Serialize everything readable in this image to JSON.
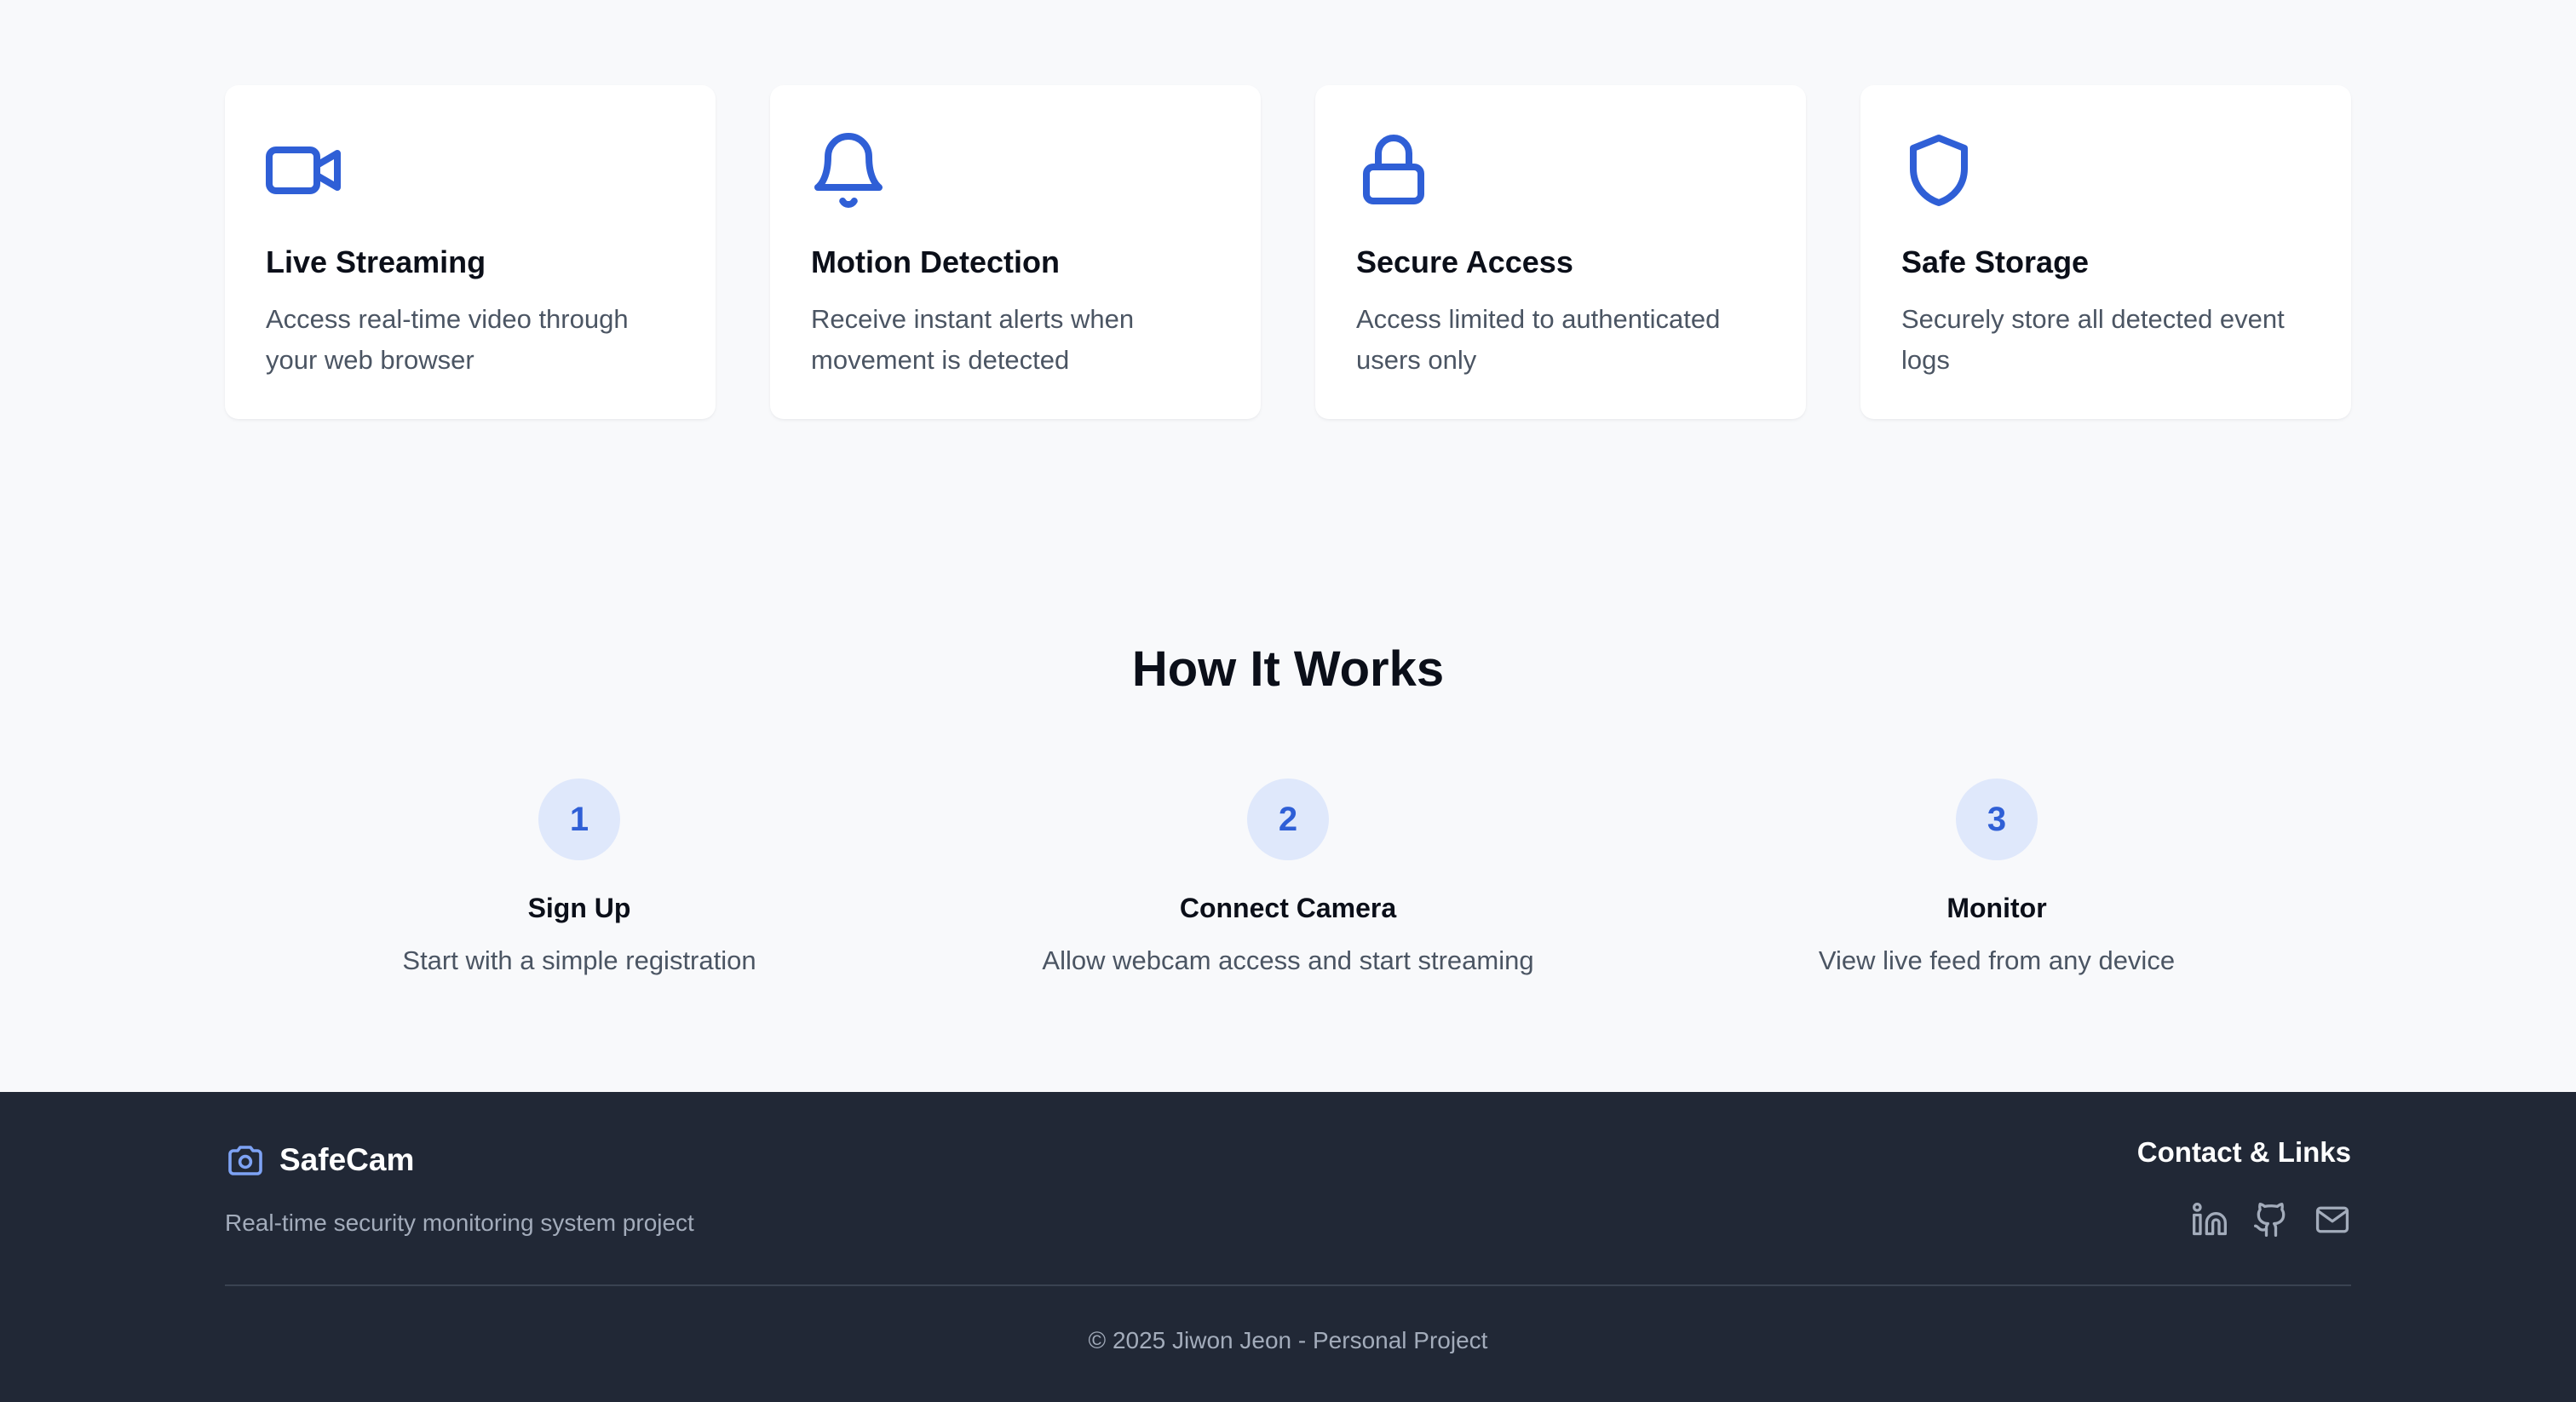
{
  "colors": {
    "accent": "#2f5fd6",
    "step_circle_bg": "#dfe8fb",
    "footer_bg": "#212836",
    "page_bg": "#f8f9fb"
  },
  "features": [
    {
      "icon": "video-camera-icon",
      "title": "Live Streaming",
      "description": "Access real-time video through your web browser"
    },
    {
      "icon": "bell-icon",
      "title": "Motion Detection",
      "description": "Receive instant alerts when movement is detected"
    },
    {
      "icon": "lock-icon",
      "title": "Secure Access",
      "description": "Access limited to authenticated users only"
    },
    {
      "icon": "shield-icon",
      "title": "Safe Storage",
      "description": "Securely store all detected event logs"
    }
  ],
  "how_it_works": {
    "title": "How It Works",
    "steps": [
      {
        "number": "1",
        "title": "Sign Up",
        "description": "Start with a simple registration"
      },
      {
        "number": "2",
        "title": "Connect Camera",
        "description": "Allow webcam access and start streaming"
      },
      {
        "number": "3",
        "title": "Monitor",
        "description": "View live feed from any device"
      }
    ]
  },
  "footer": {
    "brand_icon": "camera-icon",
    "brand_name": "SafeCam",
    "tagline": "Real-time security monitoring system project",
    "contact_title": "Contact & Links",
    "links": [
      {
        "icon": "linkedin-icon",
        "label": "LinkedIn"
      },
      {
        "icon": "github-icon",
        "label": "GitHub"
      },
      {
        "icon": "mail-icon",
        "label": "Email"
      }
    ],
    "copyright": "© 2025 Jiwon Jeon - Personal Project"
  }
}
